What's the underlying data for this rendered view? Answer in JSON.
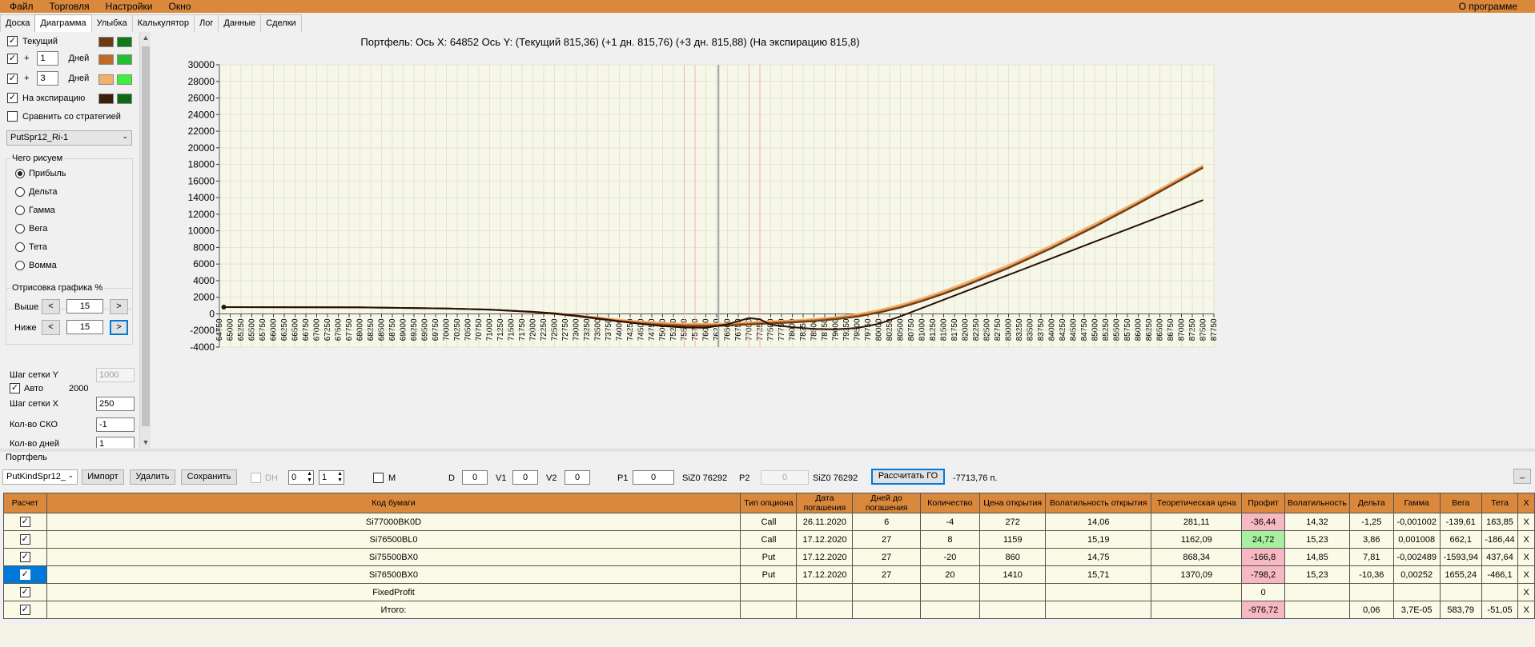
{
  "menu": {
    "file": "Файл",
    "trade": "Торговля",
    "settings": "Настройки",
    "window": "Окно",
    "about": "О программе"
  },
  "tabs": [
    "Доска",
    "Диаграмма",
    "Улыбка",
    "Калькулятор",
    "Лог",
    "Данные",
    "Сделки"
  ],
  "active_tab": "Диаграмма",
  "left": {
    "current": {
      "label": "Текущий",
      "checked": true,
      "colors": [
        "#6b3a16",
        "#0f7a1a"
      ]
    },
    "plus1": {
      "plus": "+",
      "value": "1",
      "unit": "Дней",
      "checked": true,
      "colors": [
        "#c06a2a",
        "#22c030"
      ]
    },
    "plus3": {
      "plus": "+",
      "value": "3",
      "unit": "Дней",
      "checked": true,
      "colors": [
        "#f2b068",
        "#3cf03c"
      ]
    },
    "expiry": {
      "label": "На экспирацию",
      "checked": true,
      "colors": [
        "#3a1f0a",
        "#0c6a14"
      ]
    },
    "compare": {
      "label": "Сравнить со стратегией",
      "checked": false
    },
    "strategy_select": "PutSpr12_Ri-1",
    "draw_group": {
      "title": "Чего рисуем",
      "options": [
        "Прибыль",
        "Дельта",
        "Гамма",
        "Вега",
        "Тета",
        "Вомма"
      ],
      "selected": 0
    },
    "percent_group": {
      "title": "Отрисовка графика %",
      "above_label": "Выше",
      "below_label": "Ниже",
      "above_value": "15",
      "below_value": "15",
      "dec": "<",
      "inc": ">"
    },
    "grid_y": {
      "label": "Шаг сетки Y",
      "value": "1000"
    },
    "auto": {
      "label": "Авто",
      "checked": true,
      "value": "2000"
    },
    "grid_x": {
      "label": "Шаг сетки X",
      "value": "250"
    },
    "sko": {
      "label": "Кол-во СКО",
      "value": "-1"
    },
    "days": {
      "label": "Кол-во дней",
      "value": "1"
    }
  },
  "chart_data": {
    "type": "line",
    "title": "Портфель:  Ось X: 64852 Ось Y:  (Текущий 815,36)  (+1 дн. 815,76)  (+3 дн. 815,88)  (На экспирацию 815,8)",
    "xlabel": "",
    "ylabel": "",
    "xlim": [
      64750,
      87750
    ],
    "ylim": [
      -4000,
      30000
    ],
    "x_tick_step": 250,
    "y_tick_step": 2000,
    "grid": true,
    "cursor_x": 76292,
    "red_markers_x": [
      75500,
      75750,
      77000,
      77250
    ],
    "series": [
      {
        "color": "#f2b068",
        "points": [
          [
            64852,
            816
          ],
          [
            68000,
            780
          ],
          [
            70000,
            640
          ],
          [
            71000,
            520
          ],
          [
            72000,
            260
          ],
          [
            72500,
            60
          ],
          [
            73000,
            -160
          ],
          [
            73500,
            -420
          ],
          [
            74000,
            -700
          ],
          [
            74500,
            -930
          ],
          [
            75000,
            -1090
          ],
          [
            75500,
            -1180
          ],
          [
            76000,
            -1200
          ],
          [
            76500,
            -1150
          ],
          [
            77000,
            -1020
          ],
          [
            77500,
            -900
          ],
          [
            78000,
            -780
          ],
          [
            78500,
            -620
          ],
          [
            79000,
            -380
          ],
          [
            79500,
            -40
          ],
          [
            80000,
            460
          ],
          [
            80500,
            1100
          ],
          [
            81000,
            1880
          ],
          [
            81500,
            2760
          ],
          [
            82000,
            3740
          ],
          [
            83000,
            5880
          ],
          [
            84000,
            8260
          ],
          [
            85000,
            10860
          ],
          [
            86000,
            13600
          ],
          [
            87500,
            17900
          ]
        ]
      },
      {
        "color": "#c06a2a",
        "points": [
          [
            64852,
            816
          ],
          [
            68000,
            780
          ],
          [
            70000,
            640
          ],
          [
            71000,
            520
          ],
          [
            72000,
            240
          ],
          [
            72500,
            20
          ],
          [
            73000,
            -220
          ],
          [
            73500,
            -520
          ],
          [
            74000,
            -820
          ],
          [
            74500,
            -1060
          ],
          [
            75000,
            -1240
          ],
          [
            75500,
            -1340
          ],
          [
            76000,
            -1360
          ],
          [
            76500,
            -1300
          ],
          [
            77000,
            -1160
          ],
          [
            77500,
            -1040
          ],
          [
            78000,
            -920
          ],
          [
            78500,
            -760
          ],
          [
            79000,
            -540
          ],
          [
            79500,
            -220
          ],
          [
            80000,
            260
          ],
          [
            80500,
            880
          ],
          [
            81000,
            1650
          ],
          [
            81500,
            2530
          ],
          [
            82000,
            3500
          ],
          [
            83000,
            5640
          ],
          [
            84000,
            8020
          ],
          [
            85000,
            10620
          ],
          [
            86000,
            13380
          ],
          [
            87500,
            17700
          ]
        ]
      },
      {
        "color": "#6b3a16",
        "points": [
          [
            64852,
            816
          ],
          [
            68000,
            780
          ],
          [
            70000,
            640
          ],
          [
            71000,
            510
          ],
          [
            72000,
            220
          ],
          [
            72500,
            -10
          ],
          [
            73000,
            -270
          ],
          [
            73500,
            -600
          ],
          [
            74000,
            -920
          ],
          [
            74500,
            -1180
          ],
          [
            75000,
            -1370
          ],
          [
            75500,
            -1470
          ],
          [
            76000,
            -1490
          ],
          [
            76500,
            -1420
          ],
          [
            77000,
            -1280
          ],
          [
            77500,
            -1160
          ],
          [
            78000,
            -1040
          ],
          [
            78500,
            -880
          ],
          [
            79000,
            -660
          ],
          [
            79500,
            -340
          ],
          [
            80000,
            140
          ],
          [
            80500,
            760
          ],
          [
            81000,
            1530
          ],
          [
            81500,
            2410
          ],
          [
            82000,
            3380
          ],
          [
            83000,
            5520
          ],
          [
            84000,
            7900
          ],
          [
            85000,
            10500
          ],
          [
            86000,
            13260
          ],
          [
            87500,
            17600
          ]
        ]
      },
      {
        "color": "#2a1205",
        "points": [
          [
            64852,
            816
          ],
          [
            68000,
            790
          ],
          [
            70000,
            650
          ],
          [
            71000,
            520
          ],
          [
            72000,
            250
          ],
          [
            72500,
            60
          ],
          [
            73000,
            -220
          ],
          [
            73500,
            -540
          ],
          [
            74000,
            -900
          ],
          [
            74500,
            -1210
          ],
          [
            75000,
            -1480
          ],
          [
            75500,
            -1640
          ],
          [
            76000,
            -1680
          ],
          [
            76500,
            -1250
          ],
          [
            77000,
            -500
          ],
          [
            77250,
            -650
          ],
          [
            77500,
            -1300
          ],
          [
            78000,
            -1600
          ],
          [
            78500,
            -1800
          ],
          [
            79000,
            -1850
          ],
          [
            79500,
            -1700
          ],
          [
            80000,
            -1200
          ],
          [
            80500,
            -300
          ],
          [
            81000,
            700
          ],
          [
            81500,
            1700
          ],
          [
            82000,
            2700
          ],
          [
            83000,
            4700
          ],
          [
            84000,
            6700
          ],
          [
            85000,
            8700
          ],
          [
            86000,
            10700
          ],
          [
            87500,
            13700
          ]
        ]
      }
    ]
  },
  "portfolio": {
    "label": "Портфель",
    "select": "PutKindSpr12_",
    "import": "Импорт",
    "delete": "Удалить",
    "save": "Сохранить",
    "dh": "DH",
    "spin1": "0",
    "spin2": "1",
    "m": "M",
    "d_label": "D",
    "d_value": "0",
    "v1_label": "V1",
    "v1_value": "0",
    "v2_label": "V2",
    "v2_value": "0",
    "p1_label": "P1",
    "p1_value": "0",
    "p1_sym": "SiZ0 76292",
    "p2_label": "P2",
    "p2_value": "0",
    "p2_sym": "SiZ0 76292",
    "calc": "Рассчитать ГО",
    "go_value": "-7713,76 п.",
    "underscore": "_"
  },
  "table": {
    "headers": [
      "Расчет",
      "Код бумаги",
      "Тип опциона",
      "Дата погашения",
      "Дней до погашения",
      "Количество",
      "Цена открытия",
      "Волатильность открытия",
      "Теоретическая цена",
      "Профит",
      "Волатильность",
      "Дельта",
      "Гамма",
      "Вега",
      "Тета",
      "X"
    ],
    "rows": [
      {
        "code": "Si77000BK0D",
        "type": "Call",
        "date": "26.11.2020",
        "days": "6",
        "qty": "-4",
        "price": "272",
        "vol_open": "14,06",
        "theo": "281,11",
        "profit": "-36,44",
        "profit_color": "red",
        "vol": "14,32",
        "delta": "-1,25",
        "gamma": "-0,001002",
        "vega": "-139,61",
        "theta": "163,85",
        "x": "X"
      },
      {
        "code": "Si76500BL0",
        "type": "Call",
        "date": "17.12.2020",
        "days": "27",
        "qty": "8",
        "price": "1159",
        "vol_open": "15,19",
        "theo": "1162,09",
        "profit": "24,72",
        "profit_color": "green",
        "vol": "15,23",
        "delta": "3,86",
        "gamma": "0,001008",
        "vega": "662,1",
        "theta": "-186,44",
        "x": "X"
      },
      {
        "code": "Si75500BX0",
        "type": "Put",
        "date": "17.12.2020",
        "days": "27",
        "qty": "-20",
        "price": "860",
        "vol_open": "14,75",
        "theo": "868,34",
        "profit": "-166,8",
        "profit_color": "red",
        "vol": "14,85",
        "delta": "7,81",
        "gamma": "-0,002489",
        "vega": "-1593,94",
        "theta": "437,64",
        "x": "X"
      },
      {
        "code": "Si76500BX0",
        "type": "Put",
        "date": "17.12.2020",
        "days": "27",
        "qty": "20",
        "price": "1410",
        "vol_open": "15,71",
        "theo": "1370,09",
        "profit": "-798,2",
        "profit_color": "red",
        "vol": "15,23",
        "delta": "-10,36",
        "gamma": "0,00252",
        "vega": "1655,24",
        "theta": "-466,1",
        "x": "X"
      },
      {
        "code": "FixedProfit",
        "type": "",
        "date": "",
        "days": "",
        "qty": "",
        "price": "",
        "vol_open": "",
        "theo": "",
        "profit": "0",
        "profit_color": "",
        "vol": "",
        "delta": "",
        "gamma": "",
        "vega": "",
        "theta": "",
        "x": "X"
      },
      {
        "code": "Итого:",
        "type": "",
        "date": "",
        "days": "",
        "qty": "",
        "price": "",
        "vol_open": "",
        "theo": "",
        "profit": "-976,72",
        "profit_color": "red",
        "vol": "",
        "delta": "0,06",
        "gamma": "3,7E-05",
        "vega": "583,79",
        "theta": "-51,05",
        "x": "X"
      }
    ]
  }
}
